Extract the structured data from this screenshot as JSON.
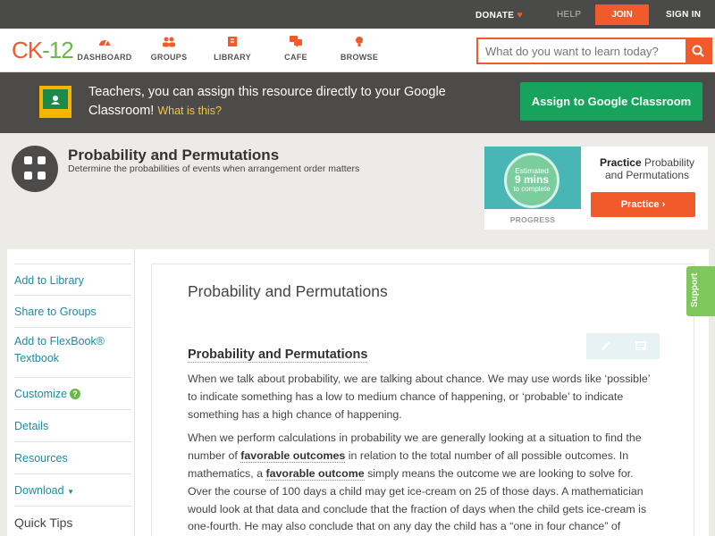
{
  "topbar": {
    "donate": "DONATE",
    "help": "HELP",
    "join": "JOIN",
    "signin": "SIGN IN"
  },
  "nav": {
    "logo_left": "CK",
    "logo_right": "-12",
    "items": [
      {
        "label": "DASHBOARD",
        "icon": "dashboard-icon"
      },
      {
        "label": "GROUPS",
        "icon": "groups-icon"
      },
      {
        "label": "LIBRARY",
        "icon": "library-icon"
      },
      {
        "label": "CAFE",
        "icon": "cafe-icon"
      },
      {
        "label": "BROWSE",
        "icon": "browse-icon"
      }
    ],
    "search_placeholder": "What do you want to learn today?"
  },
  "banner": {
    "text": "Teachers, you can assign this resource directly to your Google Classroom!",
    "link": "What is this?",
    "assign_button": "Assign to Google Classroom"
  },
  "concept": {
    "title": "Probability and Permutations",
    "subtitle": "Determine the probabilities of events when arrangement order matters"
  },
  "practice": {
    "estimated": "Estimated",
    "mins": "9 mins",
    "to_complete": "to complete",
    "progress_label": "PROGRESS",
    "title_bold": "Practice",
    "title_rest": "Probability and Permutations",
    "button": "Practice"
  },
  "sidebar": {
    "add_library": "Add to Library",
    "share_groups": "Share to Groups",
    "add_flexbook": "Add to FlexBook®",
    "add_flexbook_2": "Textbook",
    "customize": "Customize",
    "details": "Details",
    "resources": "Resources",
    "download": "Download",
    "quick_tips": "Quick Tips"
  },
  "article": {
    "title": "Probability and Permutations",
    "heading": "Probability and Permutations",
    "p1": "When we talk about probability, we are talking about chance. We may use words like ‘possible’ to indicate something has a low to medium chance of happening, or ‘probable’ to indicate something has a high chance of happening.",
    "p2_a": "When we perform calculations in probability we are generally looking at a situation to find the number of ",
    "p2_b1": "favorable outcomes",
    "p2_c": " in relation to the total number of all possible outcomes. In mathematics, a ",
    "p2_b2": "favorable outcome",
    "p2_d": " simply means the outcome we are looking to solve for. Over the course of 100 days a child may get ice-cream on 25 of those days. A mathematician would look at that data and conclude that the fraction of days when the child gets ice-cream is one-fourth. He may also conclude that on any day the child has a “one in four chance” of receiving"
  },
  "support": "Support",
  "colors": {
    "brand_orange": "#f15a2b",
    "brand_green": "#6ab847",
    "link_teal": "#1e8c9e",
    "classroom_green": "#17a35b"
  }
}
